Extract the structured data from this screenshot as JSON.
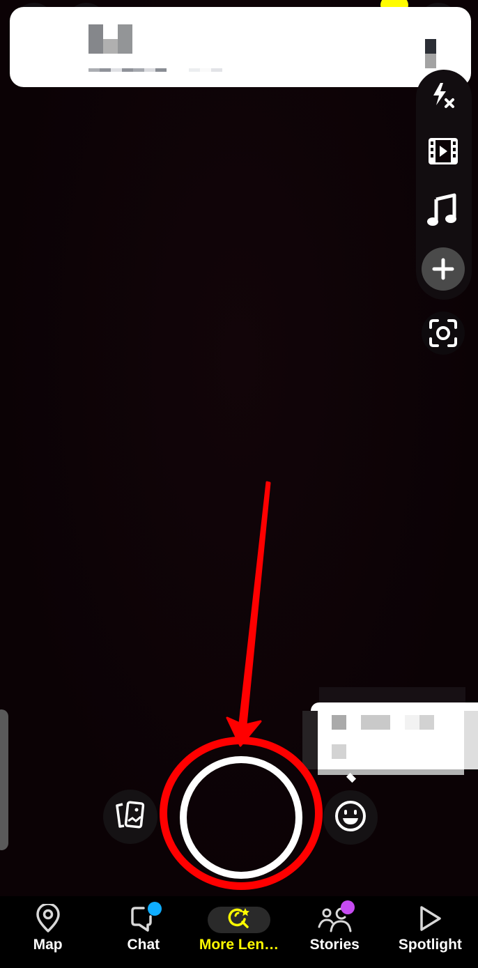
{
  "colors": {
    "accent_yellow": "#fffc00",
    "annotation_red": "#ff0000",
    "chat_dot": "#0fadff",
    "stories_dot": "#c64bf2",
    "background": "#0b0205"
  },
  "notification": {
    "title": "[redacted]",
    "subtitle": "[redacted]",
    "note": "content pixelated in screenshot"
  },
  "camera_toolbar": {
    "items": [
      {
        "name": "flash-off",
        "icon": "flash-off-icon"
      },
      {
        "name": "video",
        "icon": "film-play-icon"
      },
      {
        "name": "music",
        "icon": "music-note-icon"
      },
      {
        "name": "more",
        "icon": "plus-icon"
      },
      {
        "name": "scan",
        "icon": "scan-icon"
      }
    ]
  },
  "capture_controls": {
    "memories_icon": "memories-cards-icon",
    "shutter": "capture-button",
    "lens_icon": "smiley-icon"
  },
  "tooltip": {
    "text": "[redacted]"
  },
  "annotation": {
    "type": "arrow-and-circle",
    "target": "capture-button"
  },
  "bottom_nav": {
    "items": [
      {
        "label": "Map",
        "icon": "map-pin-icon",
        "active": false
      },
      {
        "label": "Chat",
        "icon": "chat-bubble-icon",
        "active": false,
        "badge": "blue-dot"
      },
      {
        "label": "More Len…",
        "icon": "lens-search-star-icon",
        "active": true
      },
      {
        "label": "Stories",
        "icon": "friends-icon",
        "active": false,
        "badge": "purple-dot"
      },
      {
        "label": "Spotlight",
        "icon": "play-triangle-icon",
        "active": false
      }
    ]
  }
}
